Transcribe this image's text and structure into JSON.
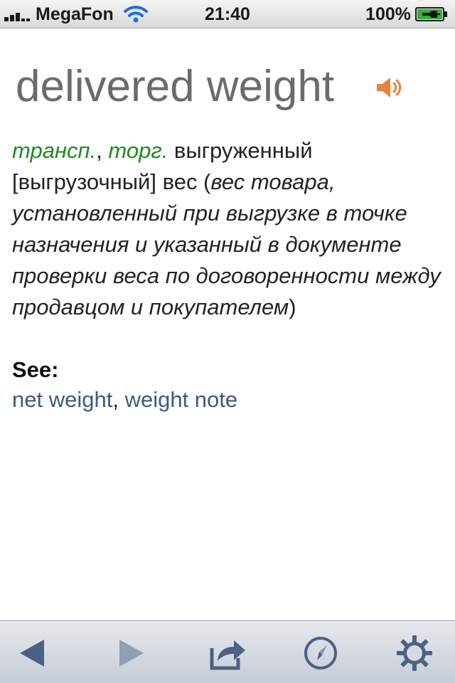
{
  "status_bar": {
    "carrier": "MegaFon",
    "time": "21:40",
    "battery": "100%"
  },
  "entry": {
    "headword": "delivered weight",
    "labels": [
      "трансп.",
      "торг."
    ],
    "label_separator": ", ",
    "translation_part1": " выгруженный [выгрузочный] вес (",
    "gloss": "вес товара, установленный при выгрузке в точке назначения и указанный в документе проверки веса по договоренности между продавцом и покупателем",
    "translation_part2": ")",
    "see_label": "See:",
    "see_also": [
      "net weight",
      "weight note"
    ],
    "see_separator": ", "
  },
  "colors": {
    "label_green": "#1f8a1f",
    "link_blue": "#3a5b84",
    "speaker_orange": "#e8823a",
    "toolbar_icon": "#4b6284"
  },
  "toolbar": {
    "icons": [
      "back-arrow-icon",
      "forward-arrow-icon",
      "share-icon",
      "compass-icon",
      "gear-icon"
    ]
  }
}
